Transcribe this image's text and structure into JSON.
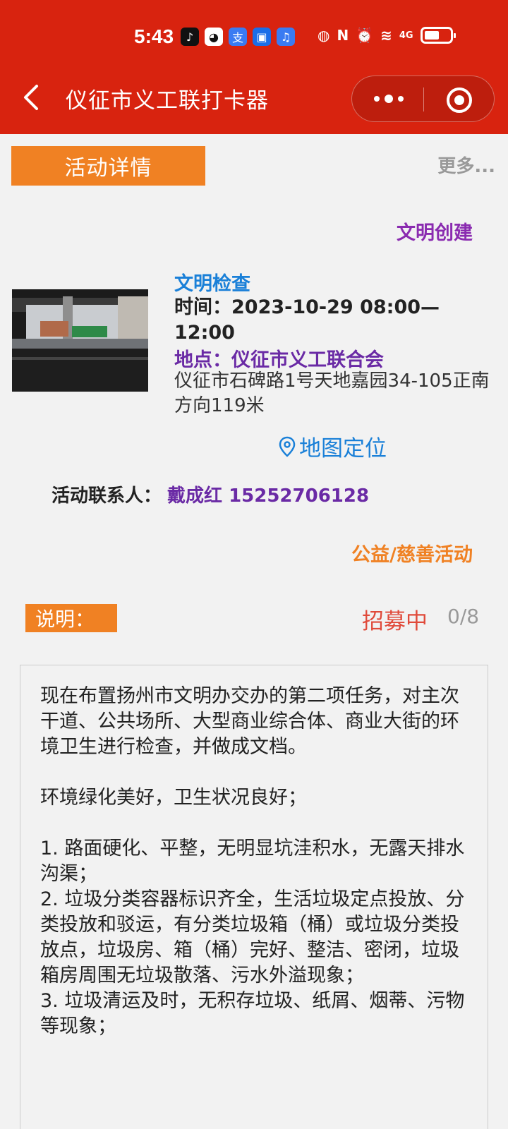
{
  "status_bar": {
    "time": "5:43",
    "network": "4G",
    "nfc": "N"
  },
  "nav": {
    "title": "仪征市义工联打卡器"
  },
  "tabs": {
    "active_label": "活动详情",
    "more_label": "更多..."
  },
  "activity": {
    "category_tag": "文明创建",
    "name": "文明检查",
    "time": "时间：2023-10-29 08:00—12:00",
    "place": "地点：仪征市义工联合会",
    "address": "仪征市石碑路1号天地嘉园34-105正南方向119米",
    "map_label": "地图定位",
    "contact_label": "活动联系人：",
    "contact_value": "戴成红 15252706128",
    "type_tag": "公益/慈善活动"
  },
  "description": {
    "label": "说明：",
    "status": "招募中",
    "count": "0/8",
    "text": "现在布置扬州市文明办交办的第二项任务，对主次干道、公共场所、大型商业综合体、商业大街的环境卫生进行检查，并做成文档。\n\n环境绿化美好，卫生状况良好；\n\n1. 路面硬化、平整，无明显坑洼积水，无露天排水沟渠；\n2. 垃圾分类容器标识齐全，生活垃圾定点投放、分类投放和驳运，有分类垃圾箱（桶）或垃圾分类投放点，垃圾房、箱（桶）完好、整洁、密闭，垃圾箱房周围无垃圾散落、污水外溢现象；\n3. 垃圾清运及时，无积存垃圾、纸屑、烟蒂、污物等现象；"
  },
  "colors": {
    "header_red": "#d8230f",
    "accent_orange": "#f08123",
    "link_blue": "#1a80d8",
    "purple": "#6a2aa5",
    "status_red": "#e04a3a"
  }
}
